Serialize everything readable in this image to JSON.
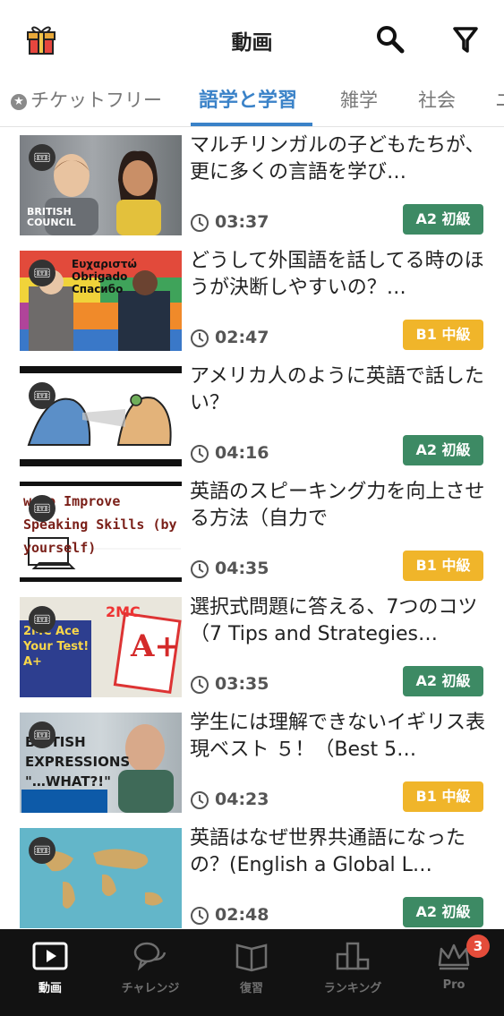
{
  "header": {
    "title": "動画"
  },
  "tabs": [
    {
      "label": "チケットフリー",
      "active": false
    },
    {
      "label": "語学と学習",
      "active": true
    },
    {
      "label": "雑学",
      "active": false
    },
    {
      "label": "社会",
      "active": false
    },
    {
      "label": "ニ",
      "active": false
    }
  ],
  "videos": [
    {
      "title": "マルチリンガルの子どもたちが、更に多くの言語を学び…",
      "duration": "03:37",
      "level": "A2 初級",
      "thumb_text": "BRITISH COUNCIL"
    },
    {
      "title": "どうして外国語を話してる時のほうが決断しやすいの？…",
      "duration": "02:47",
      "level": "B1 中級",
      "thumb_text": "Ευχαριστώ Obrigado Спасибо"
    },
    {
      "title": "アメリカ人のように英語で話したい？",
      "duration": "04:16",
      "level": "A2 初級",
      "thumb_text": ""
    },
    {
      "title": "英語のスピーキング力を向上させる方法（自力で",
      "duration": "04:35",
      "level": "B1 中級",
      "thumb_text": "w to Improve Speaking Skills (by yourself)"
    },
    {
      "title": "選択式問題に答える、7つのコツ（7 Tips and Strategies…",
      "duration": "03:35",
      "level": "A2 初級",
      "thumb_text": "2MC Ace Your Test! A+"
    },
    {
      "title": "学生には理解できないイギリス表現ベスト ５！（Best 5…",
      "duration": "04:23",
      "level": "B1 中級",
      "thumb_text": "BRITISH EXPRESSIONS \"…WHAT?!\""
    },
    {
      "title": "英語はなぜ世界共通語になったの？(English a Global L…",
      "duration": "02:48",
      "level": "A2 初級",
      "thumb_text": ""
    }
  ],
  "level_colors": {
    "A2 初級": "#3d8a64",
    "B1 中級": "#f0b52a"
  },
  "bottom_nav": [
    {
      "label": "動画",
      "icon": "play-icon",
      "active": true
    },
    {
      "label": "チャレンジ",
      "icon": "chat-bubbles-icon",
      "active": false
    },
    {
      "label": "復習",
      "icon": "book-icon",
      "active": false
    },
    {
      "label": "ランキング",
      "icon": "podium-icon",
      "active": false
    },
    {
      "label": "Pro",
      "icon": "crown-icon",
      "active": false,
      "badge": "3"
    }
  ]
}
